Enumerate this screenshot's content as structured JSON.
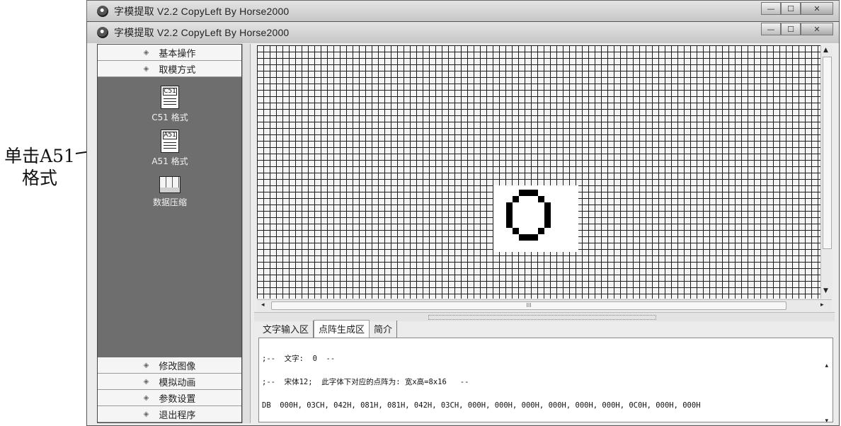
{
  "annotation": {
    "line1": "单击A51",
    "line2": "格式"
  },
  "window": {
    "title": "字模提取 V2.2  CopyLeft By Horse2000",
    "buttons": {
      "minimize": "—",
      "maximize": "☐",
      "close": "✕"
    }
  },
  "sidebar": {
    "top_items": [
      {
        "label": "基本操作"
      },
      {
        "label": "取模方式"
      }
    ],
    "tools": [
      {
        "label": "C51 格式",
        "icon": "C51"
      },
      {
        "label": "A51 格式",
        "icon": "A51"
      },
      {
        "label": "数据压缩",
        "icon": "compress-icon"
      }
    ],
    "bottom_items": [
      {
        "label": "修改图像"
      },
      {
        "label": "模拟动画"
      },
      {
        "label": "参数设置"
      },
      {
        "label": "退出程序"
      }
    ],
    "bullet": "◈"
  },
  "hscroll": {
    "thumb_label": "III"
  },
  "tabs": [
    {
      "label": "文字输入区"
    },
    {
      "label": "点阵生成区"
    },
    {
      "label": "简介"
    }
  ],
  "output": {
    "lines": [
      ";--  文字:  0  --",
      ";--  宋体12;  此字体下对应的点阵为: 宽x高=8x16   --",
      "DB  000H, 03CH, 042H, 081H, 081H, 042H, 03CH, 000H, 000H, 000H, 000H, 000H, 000H, 0C0H, 000H, 000H"
    ]
  },
  "colors": {
    "sidebar_bg": "#6e6e6e",
    "grid_line": "#1c1c1c",
    "grid_cell": "#f4f4f4"
  }
}
